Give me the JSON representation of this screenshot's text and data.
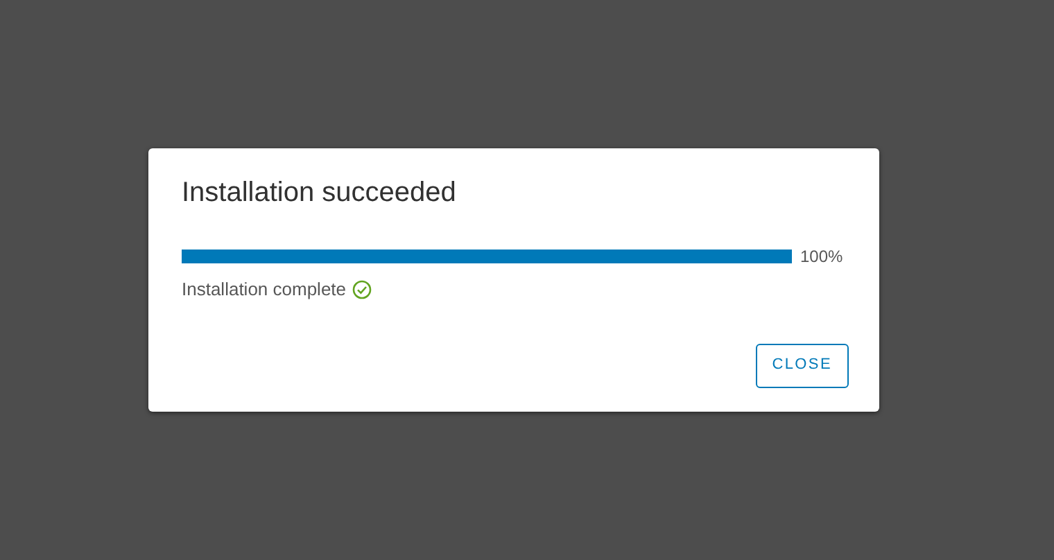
{
  "dialog": {
    "title": "Installation succeeded",
    "progress": {
      "level": 1.0,
      "reading": "100%"
    },
    "status": {
      "text": "Installation complete",
      "success": true
    },
    "buttons": [
      "CLOSE"
    ]
  }
}
